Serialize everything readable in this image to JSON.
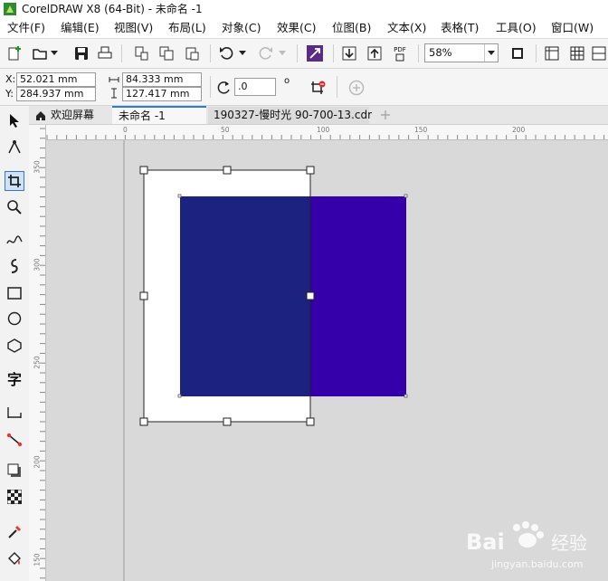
{
  "window": {
    "title": "CorelDRAW X8 (64-Bit) - 未命名 -1"
  },
  "menu": [
    "文件(F)",
    "编辑(E)",
    "视图(V)",
    "布局(L)",
    "对象(C)",
    "效果(C)",
    "位图(B)",
    "文本(X)",
    "表格(T)",
    "工具(O)",
    "窗口(W)"
  ],
  "toolbar": {
    "zoom": "58%",
    "pdf_label": "PDF"
  },
  "properties": {
    "x_label": "X:",
    "x_value": "52.021 mm",
    "y_label": "Y:",
    "y_value": "284.937 mm",
    "width_value": "84.333 mm",
    "height_value": "127.417 mm",
    "rotation_value": ".0",
    "degree_symbol": "o"
  },
  "tabs": [
    "欢迎屏幕",
    "未命名 -1",
    "190327-慢时光 90-700-13.cdr"
  ],
  "rulers": {
    "horizontal": [
      "0",
      "50",
      "100",
      "150",
      "200"
    ],
    "vertical": [
      "350",
      "300",
      "250",
      "200",
      "150"
    ]
  },
  "toolbox": {
    "text_tool_glyph": "字"
  },
  "colors": {
    "accent": "#2d7bd0",
    "rect_left": "#1c2280",
    "rect_right": "#3500aa",
    "page": "#ffffff",
    "desktop": "#d9d9d9"
  },
  "watermark": "Bai经验 jingyan.baidu.com"
}
